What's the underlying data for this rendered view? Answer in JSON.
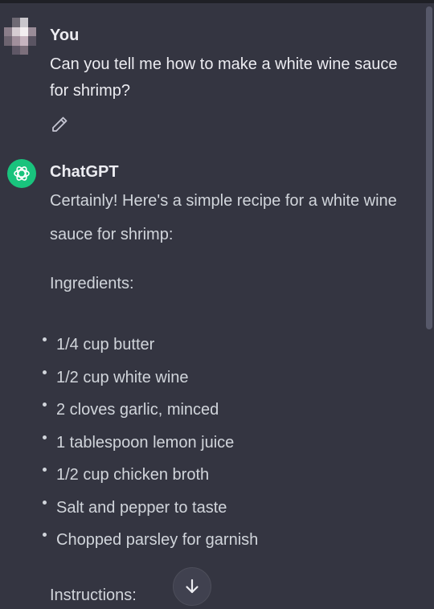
{
  "colors": {
    "background": "#343541",
    "text_primary": "#ececf1",
    "text_secondary": "#d1d5db",
    "gpt_avatar": "#19c37d",
    "scrollbar": "#565869",
    "scroll_button": "#40414f"
  },
  "user_message": {
    "author": "You",
    "text": "Can you tell me how to make a white wine sauce for shrimp?",
    "edit_icon": "pencil-icon"
  },
  "assistant_message": {
    "author": "ChatGPT",
    "avatar_icon": "openai-logo-icon",
    "intro": "Certainly! Here's a simple recipe for a white wine sauce for shrimp:",
    "ingredients_title": "Ingredients:",
    "ingredients": [
      "1/4 cup butter",
      "1/2 cup white wine",
      "2 cloves garlic, minced",
      "1 tablespoon lemon juice",
      "1/2 cup chicken broth",
      "Salt and pepper to taste",
      "Chopped parsley for garnish"
    ],
    "instructions_title": "Instructions:"
  },
  "scroll_button": {
    "icon": "arrow-down-icon"
  }
}
